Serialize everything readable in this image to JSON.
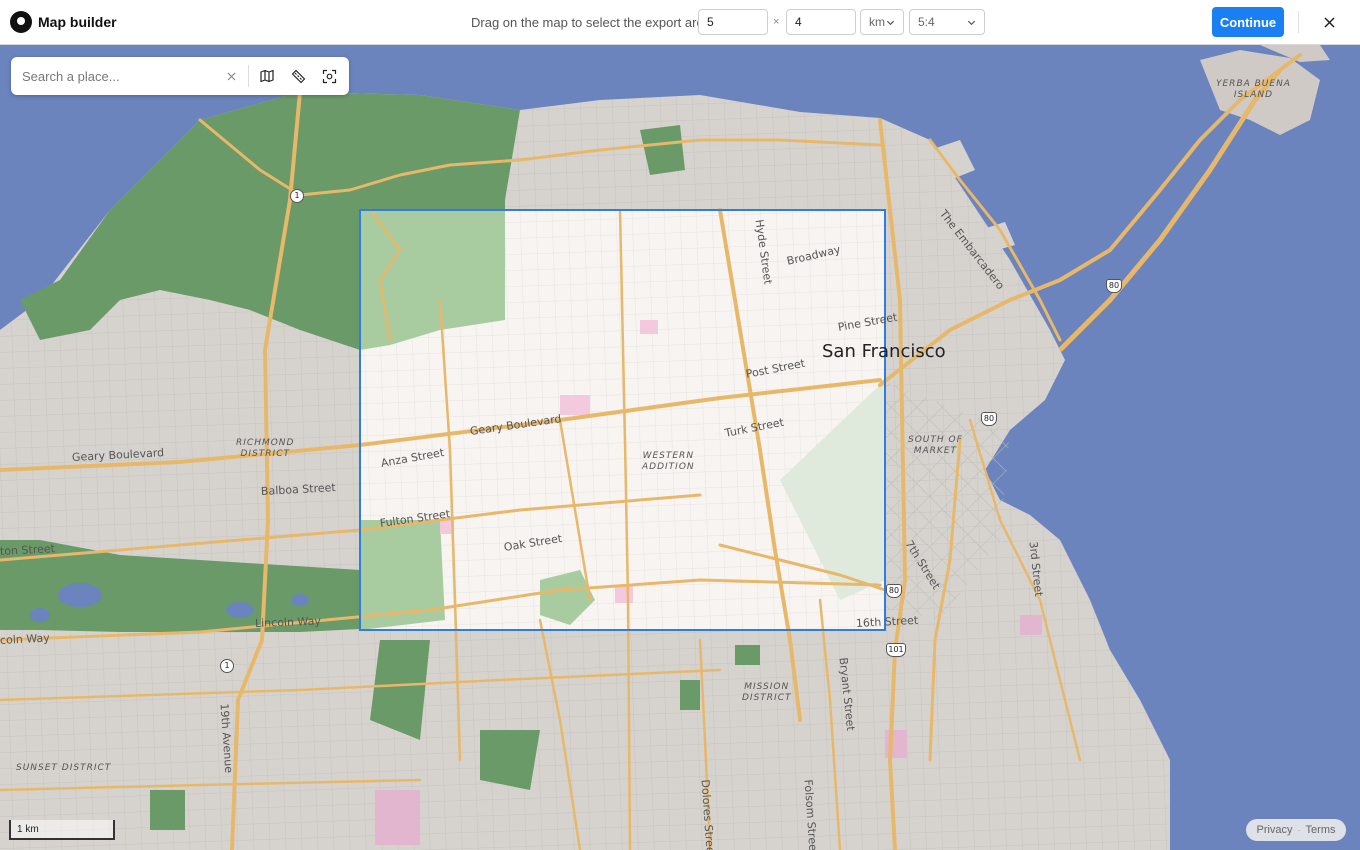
{
  "header": {
    "title": "Map builder",
    "hint": "Drag on the map to select the export area",
    "width_value": "5",
    "height_value": "4",
    "times_symbol": "×",
    "unit_selected": "km",
    "ratio_selected": "5:4",
    "continue_label": "Continue"
  },
  "search": {
    "placeholder": "Search a place..."
  },
  "map": {
    "city_label": "San Francisco",
    "street_labels": {
      "geary_boulevard_west": "Geary Boulevard",
      "geary_boulevard_east": "Geary Boulevard",
      "balboa_street": "Balboa Street",
      "anza_street": "Anza Street",
      "fulton_street": "Fulton Street",
      "oak_street": "Oak Street",
      "lincoln_way": "Lincoln Way",
      "coln_way": "coln Way",
      "ton_street": "ton Street",
      "broadway": "Broadway",
      "pine_street": "Pine Street",
      "post_street": "Post Street",
      "turk_street": "Turk Street",
      "hyde_street": "Hyde Street",
      "embarcadero": "The Embarcadero",
      "seventh_street": "7th Street",
      "third_street": "3rd Street",
      "sixteenth_street": "16th Street",
      "bryant_street": "Bryant Street",
      "dolores_street": "Dolores Street",
      "folsom_street": "Folsom Street",
      "nineteenth_avenue": "19th Avenue"
    },
    "district_labels": {
      "richmond": [
        "RICHMOND",
        "DISTRICT"
      ],
      "western_addition": [
        "WESTERN",
        "ADDITION"
      ],
      "south_of_market": [
        "SOUTH OF",
        "MARKET"
      ],
      "mission": [
        "MISSION",
        "DISTRICT"
      ],
      "sunset": [
        "SUNSET DISTRICT"
      ],
      "yerba_buena": [
        "YERBA BUENA",
        "ISLAND"
      ]
    },
    "route_shields": {
      "hwy1_north": "1",
      "hwy1_south": "1",
      "i80_bridge": "80",
      "i80_mid": "80",
      "i80_south": "80",
      "us101": "101"
    },
    "colors": {
      "water": "#6b84be",
      "land": "#d6d3cf",
      "park": "#6a9a68",
      "road_major": "#e8b86a",
      "road_minor": "#f3f1ee",
      "selection": "#2f7de1"
    }
  },
  "footer": {
    "scale_label": "1 km",
    "privacy_label": "Privacy",
    "terms_label": "Terms",
    "separator": "·"
  },
  "icons": [
    "app-logo-icon",
    "chevron-down-icon",
    "close-icon",
    "clear-icon",
    "map-style-icon",
    "measure-ruler-icon",
    "fit-selection-icon"
  ]
}
